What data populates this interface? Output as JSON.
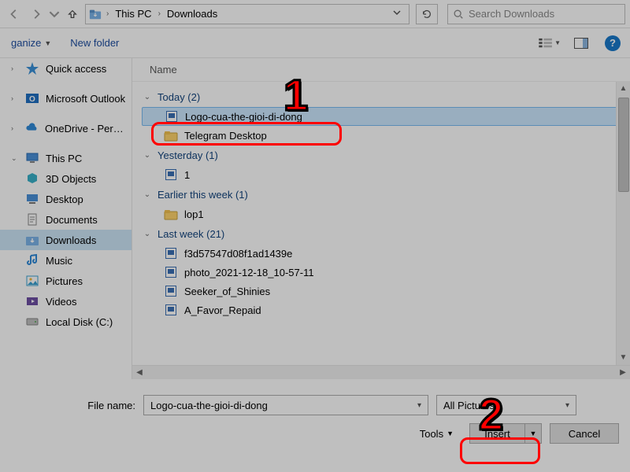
{
  "addressbar": {
    "root": "This PC",
    "folder": "Downloads",
    "search_placeholder": "Search Downloads"
  },
  "toolbar": {
    "organize": "ganize",
    "newfolder": "New folder"
  },
  "navpane": {
    "items": [
      {
        "label": "Quick access",
        "kind": "quick"
      },
      {
        "label": "Microsoft Outlook",
        "kind": "outlook"
      },
      {
        "label": "OneDrive - Person",
        "kind": "onedrive"
      },
      {
        "label": "This PC",
        "kind": "thispc"
      },
      {
        "label": "3D Objects",
        "kind": "3d"
      },
      {
        "label": "Desktop",
        "kind": "desktop"
      },
      {
        "label": "Documents",
        "kind": "documents"
      },
      {
        "label": "Downloads",
        "kind": "downloads",
        "selected": true
      },
      {
        "label": "Music",
        "kind": "music"
      },
      {
        "label": "Pictures",
        "kind": "pictures"
      },
      {
        "label": "Videos",
        "kind": "videos"
      },
      {
        "label": "Local Disk (C:)",
        "kind": "disk"
      }
    ]
  },
  "columns": {
    "name": "Name"
  },
  "groups": [
    {
      "title": "Today (2)",
      "items": [
        {
          "name": "Logo-cua-the-gioi-di-dong",
          "icon": "image",
          "selected": true
        },
        {
          "name": "Telegram Desktop",
          "icon": "folder"
        }
      ]
    },
    {
      "title": "Yesterday (1)",
      "items": [
        {
          "name": "1",
          "icon": "image"
        }
      ]
    },
    {
      "title": "Earlier this week (1)",
      "items": [
        {
          "name": "lop1",
          "icon": "folder"
        }
      ]
    },
    {
      "title": "Last week (21)",
      "items": [
        {
          "name": "f3d57547d08f1ad1439e",
          "icon": "image"
        },
        {
          "name": "photo_2021-12-18_10-57-11",
          "icon": "image"
        },
        {
          "name": "Seeker_of_Shinies",
          "icon": "image"
        },
        {
          "name": "A_Favor_Repaid",
          "icon": "image"
        }
      ]
    }
  ],
  "footer": {
    "filename_label": "File name:",
    "filename_value": "Logo-cua-the-gioi-di-dong",
    "filter": "All Pictures",
    "tools": "Tools",
    "insert": "Insert",
    "cancel": "Cancel"
  },
  "markers": {
    "one": "1",
    "two": "2"
  }
}
